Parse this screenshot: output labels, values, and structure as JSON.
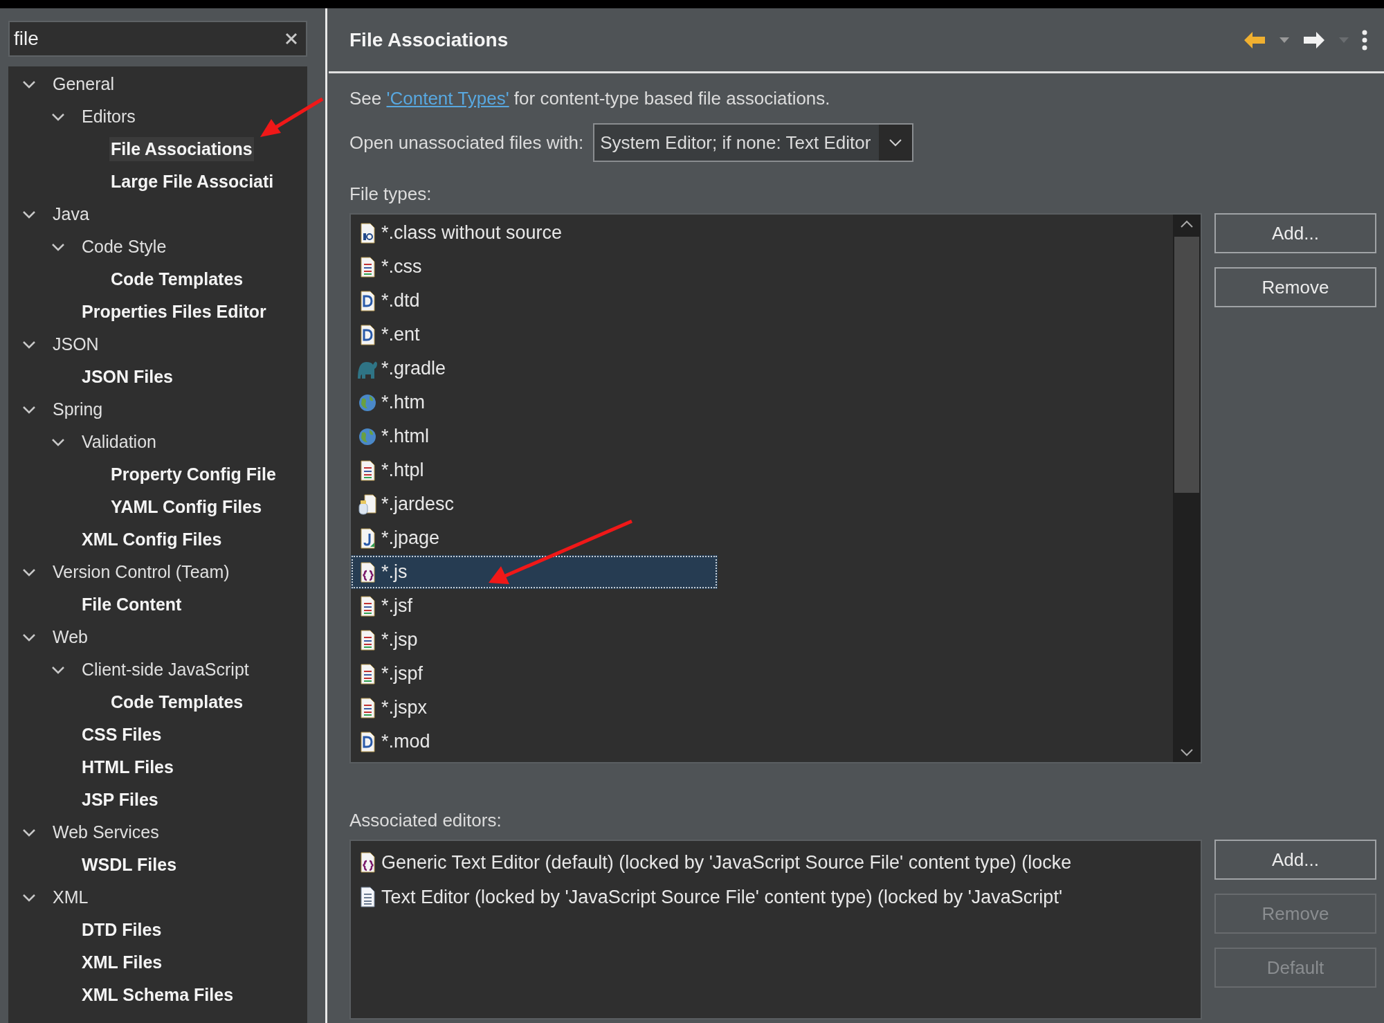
{
  "search": {
    "value": "file"
  },
  "tree": [
    {
      "label": "General",
      "matched": false,
      "selected": false,
      "expanded": true,
      "children": [
        {
          "label": "Editors",
          "matched": false,
          "selected": false,
          "expanded": true,
          "children": [
            {
              "label": "File Associations",
              "matched": true,
              "selected": true
            },
            {
              "label": "Large File Associati",
              "matched": true,
              "selected": false
            }
          ]
        }
      ]
    },
    {
      "label": "Java",
      "matched": false,
      "selected": false,
      "expanded": true,
      "children": [
        {
          "label": "Code Style",
          "matched": false,
          "selected": false,
          "expanded": true,
          "children": [
            {
              "label": "Code Templates",
              "matched": true,
              "selected": false
            }
          ]
        },
        {
          "label": "Properties Files Editor",
          "matched": true,
          "selected": false
        }
      ]
    },
    {
      "label": "JSON",
      "matched": false,
      "selected": false,
      "expanded": true,
      "children": [
        {
          "label": "JSON Files",
          "matched": true,
          "selected": false
        }
      ]
    },
    {
      "label": "Spring",
      "matched": false,
      "selected": false,
      "expanded": true,
      "children": [
        {
          "label": "Validation",
          "matched": false,
          "selected": false,
          "expanded": true,
          "children": [
            {
              "label": "Property Config File",
              "matched": true,
              "selected": false
            },
            {
              "label": "YAML Config Files",
              "matched": true,
              "selected": false
            }
          ]
        },
        {
          "label": "XML Config Files",
          "matched": true,
          "selected": false
        }
      ]
    },
    {
      "label": "Version Control (Team)",
      "matched": false,
      "selected": false,
      "expanded": true,
      "children": [
        {
          "label": "File Content",
          "matched": true,
          "selected": false
        }
      ]
    },
    {
      "label": "Web",
      "matched": false,
      "selected": false,
      "expanded": true,
      "children": [
        {
          "label": "Client-side JavaScript",
          "matched": false,
          "selected": false,
          "expanded": true,
          "children": [
            {
              "label": "Code Templates",
              "matched": true,
              "selected": false
            }
          ]
        },
        {
          "label": "CSS Files",
          "matched": true,
          "selected": false
        },
        {
          "label": "HTML Files",
          "matched": true,
          "selected": false
        },
        {
          "label": "JSP Files",
          "matched": true,
          "selected": false
        }
      ]
    },
    {
      "label": "Web Services",
      "matched": false,
      "selected": false,
      "expanded": true,
      "children": [
        {
          "label": "WSDL Files",
          "matched": true,
          "selected": false
        }
      ]
    },
    {
      "label": "XML",
      "matched": false,
      "selected": false,
      "expanded": true,
      "children": [
        {
          "label": "DTD Files",
          "matched": true,
          "selected": false
        },
        {
          "label": "XML Files",
          "matched": true,
          "selected": false
        },
        {
          "label": "XML Schema Files",
          "matched": true,
          "selected": false
        }
      ]
    }
  ],
  "page": {
    "title": "File Associations",
    "info": {
      "before": "See ",
      "link": "'Content Types'",
      "after": " for content-type based file associations."
    },
    "open_with": {
      "label": "Open unassociated files with:",
      "value": "System Editor; if none: Text Editor"
    },
    "file_types": {
      "label": "File types:",
      "items": [
        {
          "kind": "binary",
          "name": "*.class without source",
          "selected": false
        },
        {
          "kind": "text",
          "name": "*.css",
          "selected": false
        },
        {
          "kind": "dtd",
          "name": "*.dtd",
          "selected": false
        },
        {
          "kind": "dtd",
          "name": "*.ent",
          "selected": false
        },
        {
          "kind": "elephant",
          "name": "*.gradle",
          "selected": false
        },
        {
          "kind": "globe",
          "name": "*.htm",
          "selected": false
        },
        {
          "kind": "globe",
          "name": "*.html",
          "selected": false
        },
        {
          "kind": "text",
          "name": "*.htpl",
          "selected": false
        },
        {
          "kind": "jar",
          "name": "*.jardesc",
          "selected": false
        },
        {
          "kind": "java",
          "name": "*.jpage",
          "selected": false
        },
        {
          "kind": "script",
          "name": "*.js",
          "selected": true
        },
        {
          "kind": "text",
          "name": "*.jsf",
          "selected": false
        },
        {
          "kind": "text",
          "name": "*.jsp",
          "selected": false
        },
        {
          "kind": "text",
          "name": "*.jspf",
          "selected": false
        },
        {
          "kind": "text",
          "name": "*.jspx",
          "selected": false
        },
        {
          "kind": "dtd",
          "name": "*.mod",
          "selected": false
        }
      ],
      "buttons": [
        {
          "label": "Add...",
          "disabled": false
        },
        {
          "label": "Remove",
          "disabled": false
        }
      ]
    },
    "associated_editors": {
      "label": "Associated editors:",
      "items": [
        {
          "kind": "script",
          "name": "Generic Text Editor (default) (locked by 'JavaScript Source File' content type) (locke"
        },
        {
          "kind": "plain",
          "name": "Text Editor (locked by 'JavaScript Source File' content type) (locked by 'JavaScript'"
        }
      ],
      "buttons": [
        {
          "label": "Add...",
          "disabled": false
        },
        {
          "label": "Remove",
          "disabled": true
        },
        {
          "label": "Default",
          "disabled": true
        }
      ]
    }
  }
}
